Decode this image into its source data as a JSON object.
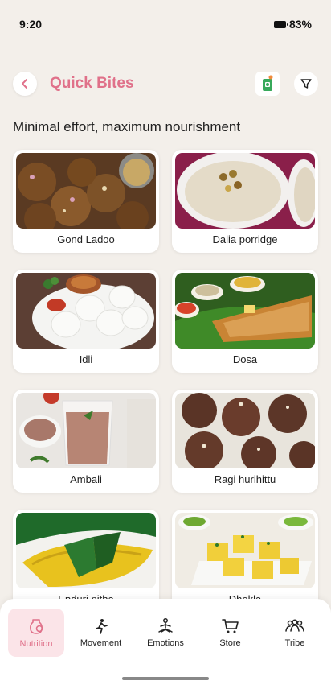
{
  "status_bar": {
    "time": "9:20",
    "battery": "83%"
  },
  "header": {
    "title": "Quick Bites"
  },
  "subtitle": "Minimal effort, maximum nourishment",
  "items": [
    {
      "label": "Gond Ladoo"
    },
    {
      "label": "Dalia porridge"
    },
    {
      "label": "Idli"
    },
    {
      "label": "Dosa"
    },
    {
      "label": "Ambali"
    },
    {
      "label": "Ragi hurihittu"
    },
    {
      "label": "Enduri pitha"
    },
    {
      "label": "Dhokla"
    }
  ],
  "nav": [
    {
      "label": "Nutrition",
      "active": true
    },
    {
      "label": "Movement"
    },
    {
      "label": "Emotions"
    },
    {
      "label": "Store"
    },
    {
      "label": "Tribe"
    }
  ],
  "colors": {
    "accent": "#e0718a",
    "background": "#f3efea"
  }
}
